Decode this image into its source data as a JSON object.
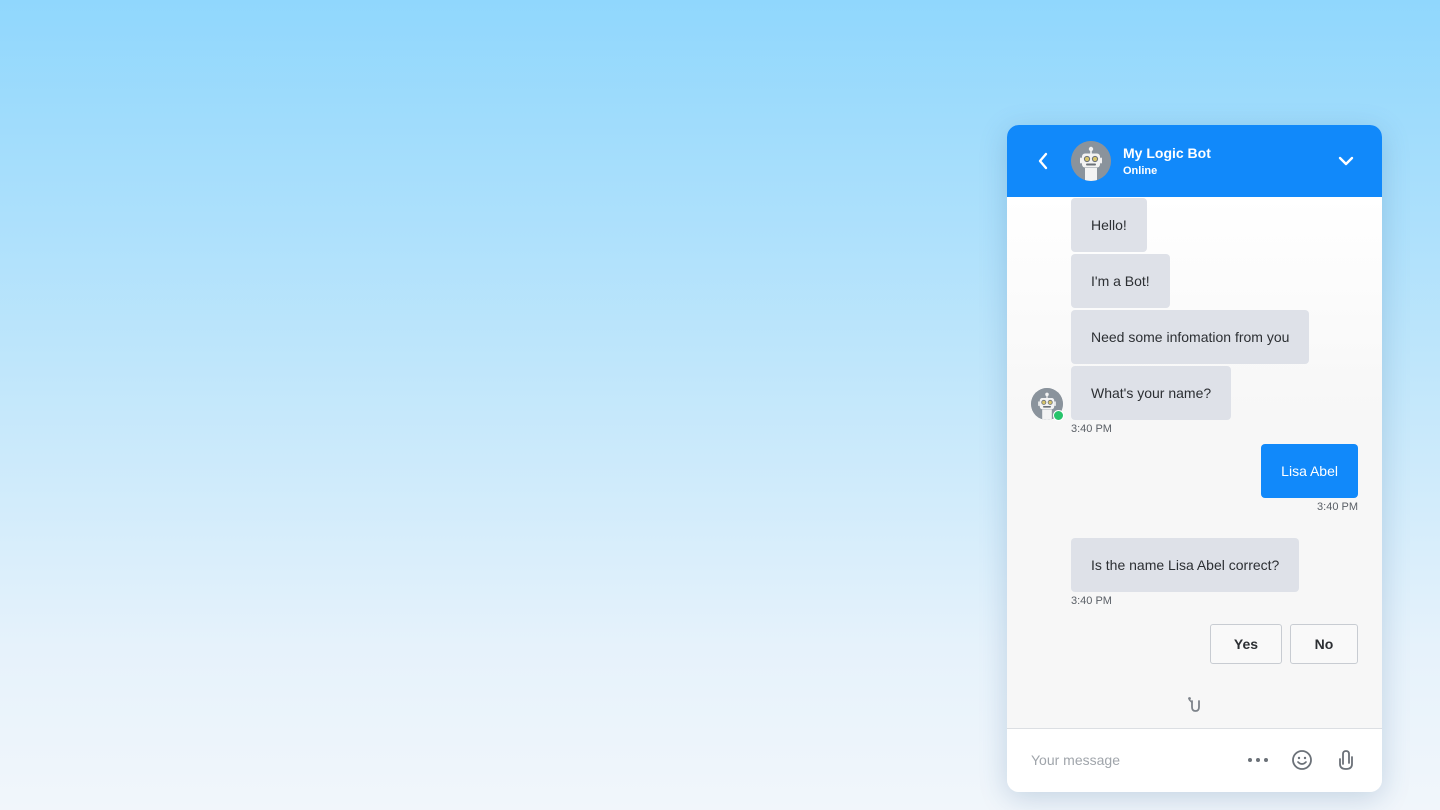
{
  "header": {
    "title": "My Logic Bot",
    "status": "Online"
  },
  "messages": [
    {
      "sender": "bot",
      "text": "Hello!"
    },
    {
      "sender": "bot",
      "text": "I'm a Bot!"
    },
    {
      "sender": "bot",
      "text": "Need some infomation from you"
    },
    {
      "sender": "bot",
      "text": "What's your name?",
      "time": "3:40 PM"
    },
    {
      "sender": "user",
      "text": "Lisa Abel",
      "time": "3:40 PM"
    },
    {
      "sender": "bot",
      "text": "Is the name Lisa Abel correct?",
      "time": "3:40 PM"
    }
  ],
  "quick_replies": [
    "Yes",
    "No"
  ],
  "composer": {
    "placeholder": "Your message"
  },
  "colors": {
    "accent": "#1189fa",
    "bot_bubble": "#dee1e8",
    "online": "#27c46b"
  },
  "icons": [
    "chevron-left-icon",
    "bot-avatar-icon",
    "chevron-down-icon",
    "brand-logo-icon",
    "more-dots-icon",
    "emoji-icon",
    "microphone-icon"
  ]
}
